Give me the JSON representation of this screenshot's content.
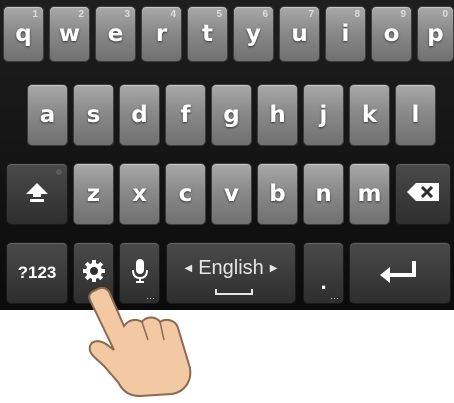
{
  "keyboard": {
    "row1": [
      {
        "char": "q",
        "num": "1"
      },
      {
        "char": "w",
        "num": "2"
      },
      {
        "char": "e",
        "num": "3"
      },
      {
        "char": "r",
        "num": "4"
      },
      {
        "char": "t",
        "num": "5"
      },
      {
        "char": "y",
        "num": "6"
      },
      {
        "char": "u",
        "num": "7"
      },
      {
        "char": "i",
        "num": "8"
      },
      {
        "char": "o",
        "num": "9"
      },
      {
        "char": "p",
        "num": "0"
      }
    ],
    "row2": [
      "a",
      "s",
      "d",
      "f",
      "g",
      "h",
      "j",
      "k",
      "l"
    ],
    "row3": [
      "z",
      "x",
      "c",
      "v",
      "b",
      "n",
      "m"
    ],
    "symbols_label": "?123",
    "language_label": "English",
    "period_label": ".",
    "icons": {
      "shift": "shift-arrow-icon",
      "delete": "backspace-icon",
      "settings": "gear-icon",
      "mic": "microphone-icon",
      "enter": "return-arrow-icon",
      "hand": "pointing-hand-icon"
    }
  },
  "colors": {
    "background": "#111111",
    "key": "#8a8a8a",
    "key_dark": "#2e2e2e",
    "text": "#ffffff",
    "hand": "#f2c9a2"
  }
}
